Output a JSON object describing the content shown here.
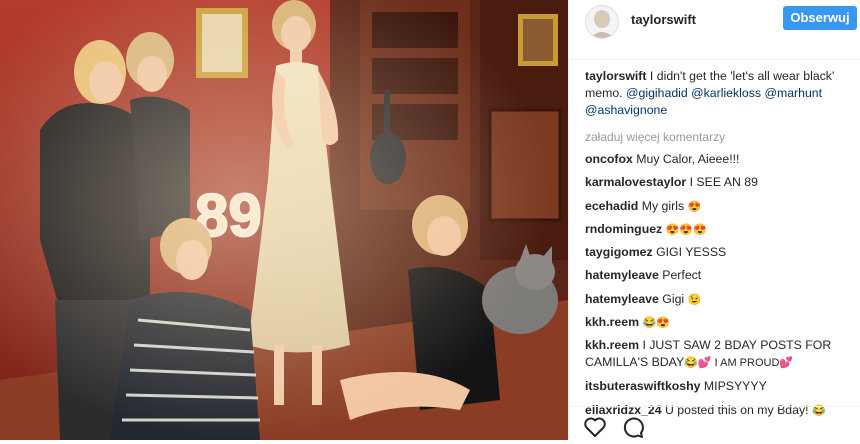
{
  "header": {
    "username": "taylorswift",
    "follow_label": "Obserwuj"
  },
  "caption": {
    "username": "taylorswift",
    "text": "I didn't get the 'let's all wear black' memo.",
    "mentions": [
      "@gigihadid",
      "@karliekloss",
      "@marhunt",
      "@ashavignone"
    ]
  },
  "load_more": "załaduj więcej komentarzy",
  "comments": [
    {
      "user": "oncofox",
      "text": "Muy Calor, Aieee!!!",
      "emoji": ""
    },
    {
      "user": "karmalovestaylor",
      "text": "I SEE AN 89",
      "emoji": ""
    },
    {
      "user": "ecehadid",
      "text": "My girls",
      "emoji": "😍"
    },
    {
      "user": "rndominguez",
      "text": "",
      "emoji": "😍😍😍"
    },
    {
      "user": "taygigomez",
      "text": "GIGI YESSS",
      "emoji": ""
    },
    {
      "user": "hatemyleave",
      "text": "Perfect",
      "emoji": ""
    },
    {
      "user": "hatemyleave",
      "text": "Gigi",
      "emoji": "😉"
    },
    {
      "user": "kkh.reem",
      "text": "",
      "emoji": "😂😍"
    },
    {
      "user": "kkh.reem",
      "text": "I JUST SAW 2 BDAY POSTS FOR CAMILLA'S BDAY",
      "emoji": "😂💕 I AM PROUD💕"
    },
    {
      "user": "itsbuteraswiftkoshy",
      "text": "MIPSYYYY",
      "emoji": ""
    },
    {
      "user": "ellaxridzx_24",
      "text": "U posted this on my Bday!",
      "emoji": "😂"
    }
  ],
  "photo": {
    "marquee_digits": "89"
  },
  "icons": {
    "like": "heart-icon",
    "comment": "comment-icon"
  }
}
